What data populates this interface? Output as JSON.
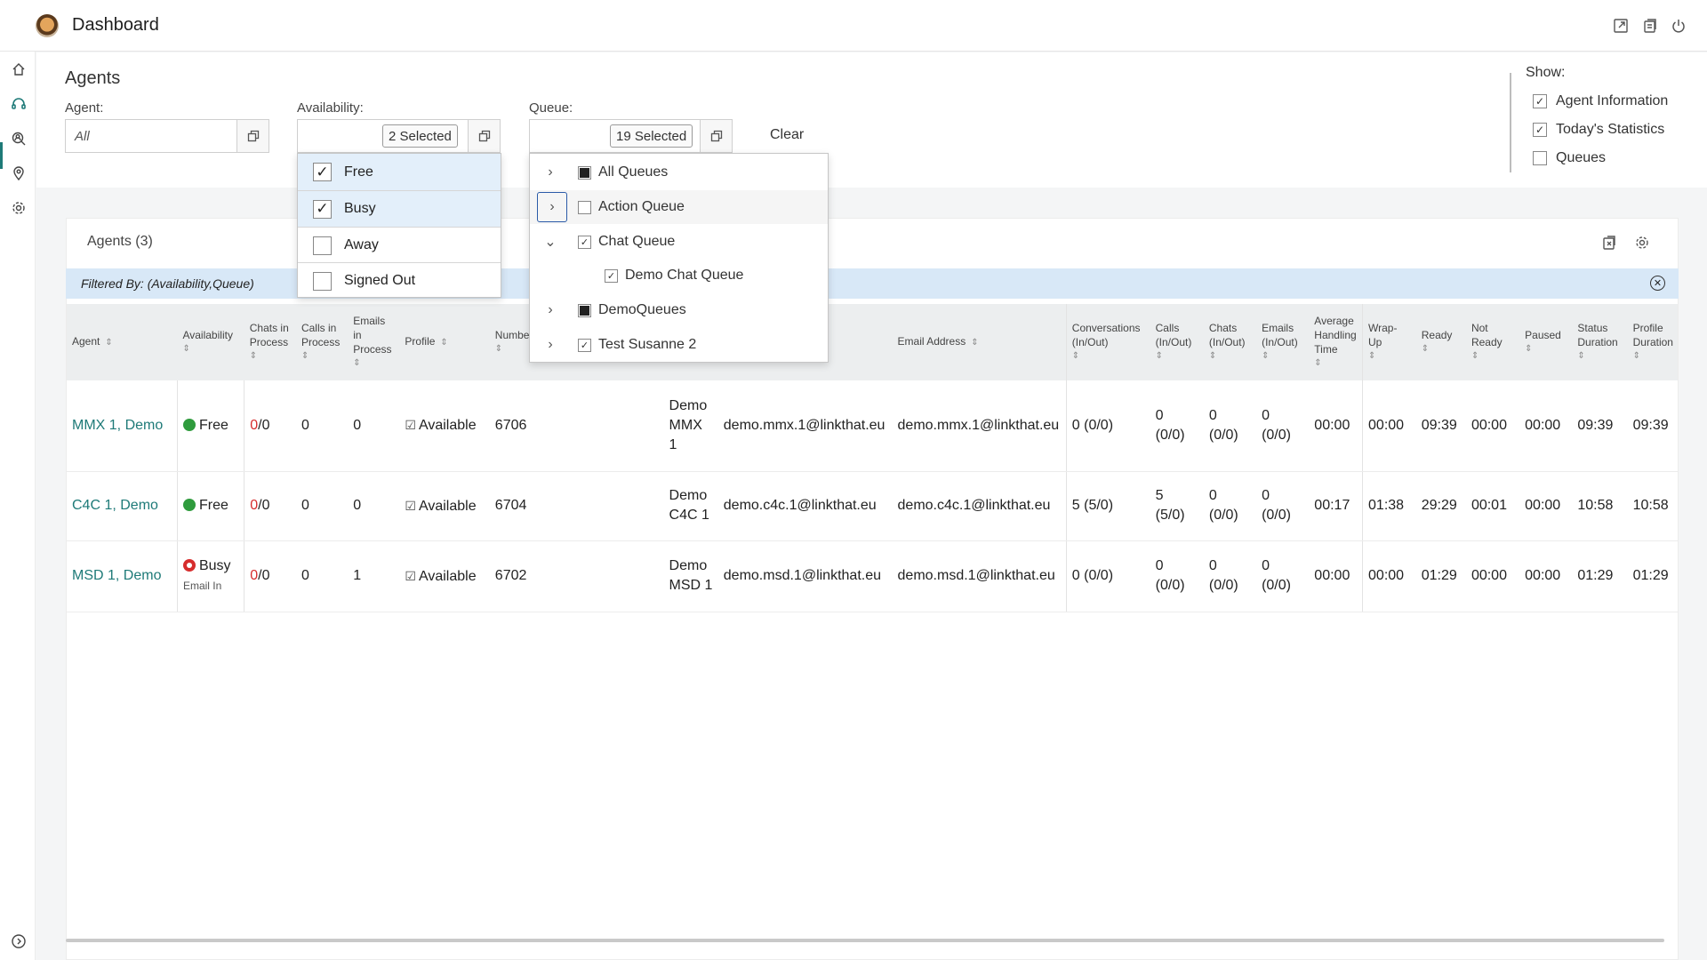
{
  "app": {
    "title": "Dashboard"
  },
  "page": {
    "title": "Agents"
  },
  "filters": {
    "agent_label": "Agent:",
    "agent_placeholder": "All",
    "availability_label": "Availability:",
    "availability_value": "2 Selected",
    "queue_label": "Queue:",
    "queue_value": "19 Selected",
    "clear_label": "Clear"
  },
  "show": {
    "label": "Show:",
    "options": [
      {
        "label": "Agent Information",
        "checked": true
      },
      {
        "label": "Today's Statistics",
        "checked": true
      },
      {
        "label": "Queues",
        "checked": false
      }
    ]
  },
  "availability_dropdown": [
    {
      "label": "Free",
      "checked": true
    },
    {
      "label": "Busy",
      "checked": true
    },
    {
      "label": "Away",
      "checked": false
    },
    {
      "label": "Signed Out",
      "checked": false
    }
  ],
  "queue_dropdown": [
    {
      "label": "All Queues",
      "state": "partial",
      "expander": "collapsed"
    },
    {
      "label": "Action Queue",
      "state": "unchecked",
      "expander": "collapsed"
    },
    {
      "label": "Chat Queue",
      "state": "checked",
      "expander": "expanded"
    },
    {
      "label": "Demo Chat Queue",
      "state": "checked",
      "expander": "none"
    },
    {
      "label": "DemoQueues",
      "state": "partial",
      "expander": "collapsed"
    },
    {
      "label": "Test Susanne 2",
      "state": "checked",
      "expander": "collapsed"
    }
  ],
  "panel": {
    "title": "Agents (3)",
    "filtered_by": "Filtered By: (Availability,Queue)"
  },
  "table": {
    "headers": {
      "agent": "Agent",
      "availability": "Availability",
      "chats_in_process": "Chats in Process",
      "calls_in_process": "Calls in Process",
      "emails_in_process": "Emails in Process",
      "profile": "Profile",
      "number": "Number",
      "email_address": "Email Address",
      "conversations": "Conversations (In/Out)",
      "calls": "Calls (In/Out)",
      "chats": "Chats (In/Out)",
      "emails": "Emails (In/Out)",
      "aht": "Average Handling Time",
      "wrapup": "Wrap-Up",
      "ready": "Ready",
      "not_ready": "Not Ready",
      "paused": "Paused",
      "status_duration": "Status Duration",
      "profile_duration": "Profile Duration"
    },
    "rows": [
      {
        "agent": "MMX 1, Demo",
        "status": "Free",
        "status_sub": "",
        "chats_a": "0",
        "chats_b": "/0",
        "calls": "0",
        "emails": "0",
        "profile": "Available",
        "number": "6706",
        "name": "Demo MMX 1",
        "user": "demo.mmx.1@linkthat.eu",
        "email": "demo.mmx.1@linkthat.eu",
        "conversations": "0 (0/0)",
        "calls_t": "0",
        "calls_s": "(0/0)",
        "chats_t": "0",
        "chats_s": "(0/0)",
        "emails_t": "0",
        "emails_s": "(0/0)",
        "aht": "00:00",
        "wrapup": "00:00",
        "ready": "09:39",
        "not_ready": "00:00",
        "paused": "00:00",
        "status_duration": "09:39",
        "profile_duration": "09:39"
      },
      {
        "agent": "C4C 1, Demo",
        "status": "Free",
        "status_sub": "",
        "chats_a": "0",
        "chats_b": "/0",
        "calls": "0",
        "emails": "0",
        "profile": "Available",
        "number": "6704",
        "name": "Demo C4C 1",
        "user": "demo.c4c.1@linkthat.eu",
        "email": "demo.c4c.1@linkthat.eu",
        "conversations": "5 (5/0)",
        "calls_t": "5",
        "calls_s": "(5/0)",
        "chats_t": "0",
        "chats_s": "(0/0)",
        "emails_t": "0",
        "emails_s": "(0/0)",
        "aht": "00:17",
        "wrapup": "01:38",
        "ready": "29:29",
        "not_ready": "00:01",
        "paused": "00:00",
        "status_duration": "10:58",
        "profile_duration": "10:58"
      },
      {
        "agent": "MSD 1, Demo",
        "status": "Busy",
        "status_sub": "Email In",
        "chats_a": "0",
        "chats_b": "/0",
        "calls": "0",
        "emails": "1",
        "profile": "Available",
        "number": "6702",
        "name": "Demo MSD 1",
        "user": "demo.msd.1@linkthat.eu",
        "email": "demo.msd.1@linkthat.eu",
        "conversations": "0 (0/0)",
        "calls_t": "0",
        "calls_s": "(0/0)",
        "chats_t": "0",
        "chats_s": "(0/0)",
        "emails_t": "0",
        "emails_s": "(0/0)",
        "aht": "00:00",
        "wrapup": "00:00",
        "ready": "01:29",
        "not_ready": "00:00",
        "paused": "00:00",
        "status_duration": "01:29",
        "profile_duration": "01:29"
      }
    ]
  },
  "colors": {
    "accent": "#1e7a78",
    "filter_bar": "#d8e8f7",
    "free": "#2f9b3d",
    "busy": "#d62d2d"
  },
  "icons": {
    "topbar": [
      "expand-icon",
      "notes-icon",
      "power-icon"
    ],
    "rail": [
      "home-icon",
      "headset-icon",
      "search-people-icon",
      "location-icon",
      "settings-icon",
      "collapse-icon"
    ],
    "panel": [
      "export-icon",
      "settings-icon"
    ]
  }
}
